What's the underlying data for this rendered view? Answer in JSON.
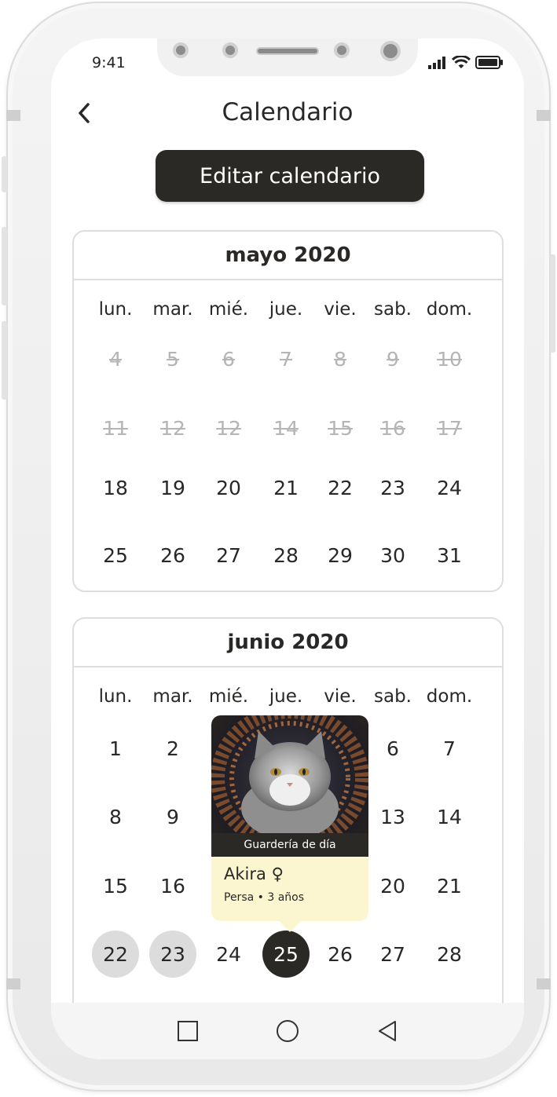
{
  "status_bar": {
    "time": "9:41"
  },
  "header": {
    "title": "Calendario",
    "edit_button": "Editar calendario"
  },
  "weekdays": [
    "lun.",
    "mar.",
    "mié.",
    "jue.",
    "vie.",
    "sab.",
    "dom."
  ],
  "may": {
    "title": "mayo 2020",
    "rows": [
      [
        "4",
        "5",
        "6",
        "7",
        "8",
        "9",
        "10"
      ],
      [
        "11",
        "12",
        "12",
        "14",
        "15",
        "16",
        "17"
      ],
      [
        "18",
        "19",
        "20",
        "21",
        "22",
        "23",
        "24"
      ],
      [
        "25",
        "26",
        "27",
        "28",
        "29",
        "30",
        "31"
      ]
    ],
    "past_rows": [
      0,
      1
    ]
  },
  "june": {
    "title": "junio 2020",
    "rows": [
      [
        "1",
        "2",
        "",
        "",
        "",
        "6",
        "7"
      ],
      [
        "8",
        "9",
        "",
        "",
        "",
        "13",
        "14"
      ],
      [
        "15",
        "16",
        "",
        "",
        "",
        "20",
        "21"
      ],
      [
        "22",
        "23",
        "24",
        "25",
        "26",
        "27",
        "28"
      ]
    ],
    "grey_days": [
      "22",
      "23"
    ],
    "selected_day": "25"
  },
  "pet_popover": {
    "service": "Guardería de día",
    "name": "Akira",
    "gender_symbol": "♀",
    "details": "Persa • 3 años"
  },
  "colors": {
    "dark": "#2b2926",
    "past_text": "#b5b5b5",
    "popover_bg": "#fbf6d0",
    "grey_circle": "#dcdcdc"
  }
}
